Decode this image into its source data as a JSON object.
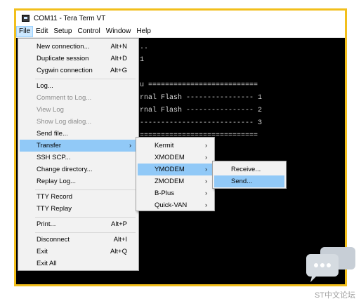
{
  "window": {
    "title": "COM11 - Tera Term VT"
  },
  "menubar": [
    "File",
    "Edit",
    "Setup",
    "Control",
    "Window",
    "Help"
  ],
  "terminal_lines": [
    "..",
    "1",
    "",
    "u ==========================",
    "rnal Flash ---------------- 1",
    "rnal Flash ---------------- 2",
    "--------------------------- 3",
    "",
    "============================"
  ],
  "file_menu": {
    "items": [
      {
        "label": "New connection...",
        "shortcut": "Alt+N",
        "state": "normal"
      },
      {
        "label": "Duplicate session",
        "shortcut": "Alt+D",
        "state": "normal"
      },
      {
        "label": "Cygwin connection",
        "shortcut": "Alt+G",
        "state": "normal"
      },
      {
        "label": "Log...",
        "shortcut": "",
        "state": "normal"
      },
      {
        "label": "Comment to Log...",
        "shortcut": "",
        "state": "disabled"
      },
      {
        "label": "View Log",
        "shortcut": "",
        "state": "disabled"
      },
      {
        "label": "Show Log dialog...",
        "shortcut": "",
        "state": "disabled"
      },
      {
        "label": "Send file...",
        "shortcut": "",
        "state": "normal"
      },
      {
        "label": "Transfer",
        "shortcut": "",
        "state": "highlight",
        "submenu": true
      },
      {
        "label": "SSH SCP...",
        "shortcut": "",
        "state": "normal"
      },
      {
        "label": "Change directory...",
        "shortcut": "",
        "state": "normal"
      },
      {
        "label": "Replay Log...",
        "shortcut": "",
        "state": "normal"
      },
      {
        "label": "TTY Record",
        "shortcut": "",
        "state": "normal"
      },
      {
        "label": "TTY Replay",
        "shortcut": "",
        "state": "normal"
      },
      {
        "label": "Print...",
        "shortcut": "Alt+P",
        "state": "normal"
      },
      {
        "label": "Disconnect",
        "shortcut": "Alt+I",
        "state": "normal"
      },
      {
        "label": "Exit",
        "shortcut": "Alt+Q",
        "state": "normal"
      },
      {
        "label": "Exit All",
        "shortcut": "",
        "state": "normal"
      }
    ]
  },
  "transfer_menu": {
    "items": [
      {
        "label": "Kermit",
        "state": "normal"
      },
      {
        "label": "XMODEM",
        "state": "normal"
      },
      {
        "label": "YMODEM",
        "state": "highlight"
      },
      {
        "label": "ZMODEM",
        "state": "normal"
      },
      {
        "label": "B-Plus",
        "state": "normal"
      },
      {
        "label": "Quick-VAN",
        "state": "normal"
      }
    ]
  },
  "ymodem_menu": {
    "items": [
      {
        "label": "Receive...",
        "state": "normal"
      },
      {
        "label": "Send...",
        "state": "highlight"
      }
    ]
  },
  "watermark": "ST中文论坛",
  "colors": {
    "frame": "#f2bf1c",
    "menu_highlight": "#91c9f7",
    "terminal_bg": "#000000"
  }
}
